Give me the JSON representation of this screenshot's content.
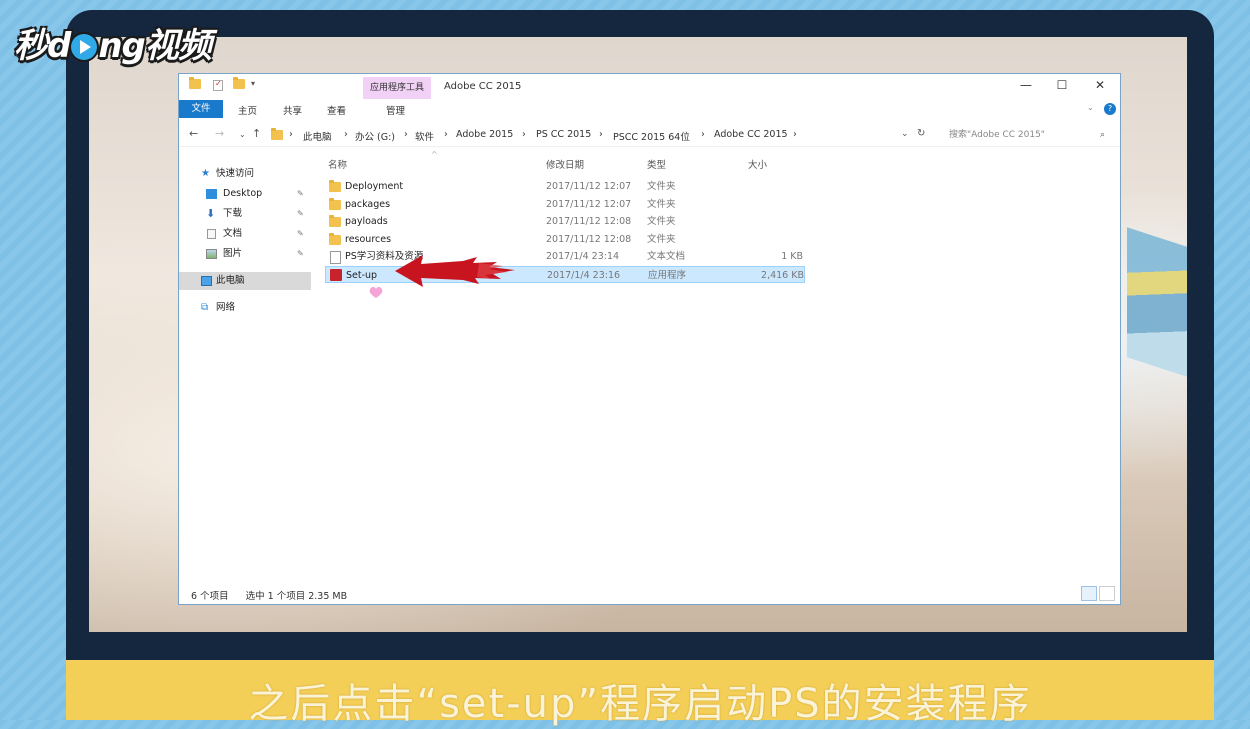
{
  "logo": {
    "text_pre": "秒d",
    "text_post": "ng视频"
  },
  "subtitle": "之后点击“set-up”程序启动PS的安装程序",
  "window": {
    "context_tab": "应用程序工具",
    "title": "Adobe CC 2015",
    "controls": {
      "minimize": "—",
      "maximize": "☐",
      "close": "✕"
    },
    "ribbon_tabs": {
      "file": "文件",
      "home": "主页",
      "share": "共享",
      "view": "查看",
      "manage": "管理"
    },
    "help": "?"
  },
  "address_bar": {
    "crumbs": [
      "此电脑",
      "办公 (G:)",
      "软件",
      "Adobe 2015",
      "PS CC 2015",
      "PSCC 2015 64位",
      "Adobe CC 2015"
    ],
    "separator": "›",
    "search_placeholder": "搜索\"Adobe CC 2015\""
  },
  "nav_pane": {
    "quick_access": "快速访问",
    "items": [
      "Desktop",
      "下载",
      "文档",
      "图片"
    ],
    "this_pc": "此电脑",
    "network": "网络"
  },
  "columns": {
    "name": "名称",
    "date": "修改日期",
    "type": "类型",
    "size": "大小"
  },
  "files": [
    {
      "name": "Deployment",
      "date": "2017/11/12 12:07",
      "type": "文件夹",
      "size": "",
      "kind": "folder"
    },
    {
      "name": "packages",
      "date": "2017/11/12 12:07",
      "type": "文件夹",
      "size": "",
      "kind": "folder"
    },
    {
      "name": "payloads",
      "date": "2017/11/12 12:08",
      "type": "文件夹",
      "size": "",
      "kind": "folder"
    },
    {
      "name": "resources",
      "date": "2017/11/12 12:08",
      "type": "文件夹",
      "size": "",
      "kind": "folder"
    },
    {
      "name": "PS学习资料及资源",
      "date": "2017/1/4 23:14",
      "type": "文本文档",
      "size": "1 KB",
      "kind": "text"
    },
    {
      "name": "Set-up",
      "date": "2017/1/4 23:16",
      "type": "应用程序",
      "size": "2,416 KB",
      "kind": "app"
    }
  ],
  "status": {
    "count": "6 个项目",
    "selected": "选中 1 个项目 2.35 MB"
  },
  "colors": {
    "ribbon_blue": "#1979ca",
    "selection": "#cce8ff",
    "arrow_red": "#c8141e",
    "subtitle_bar": "#f4cf58"
  }
}
